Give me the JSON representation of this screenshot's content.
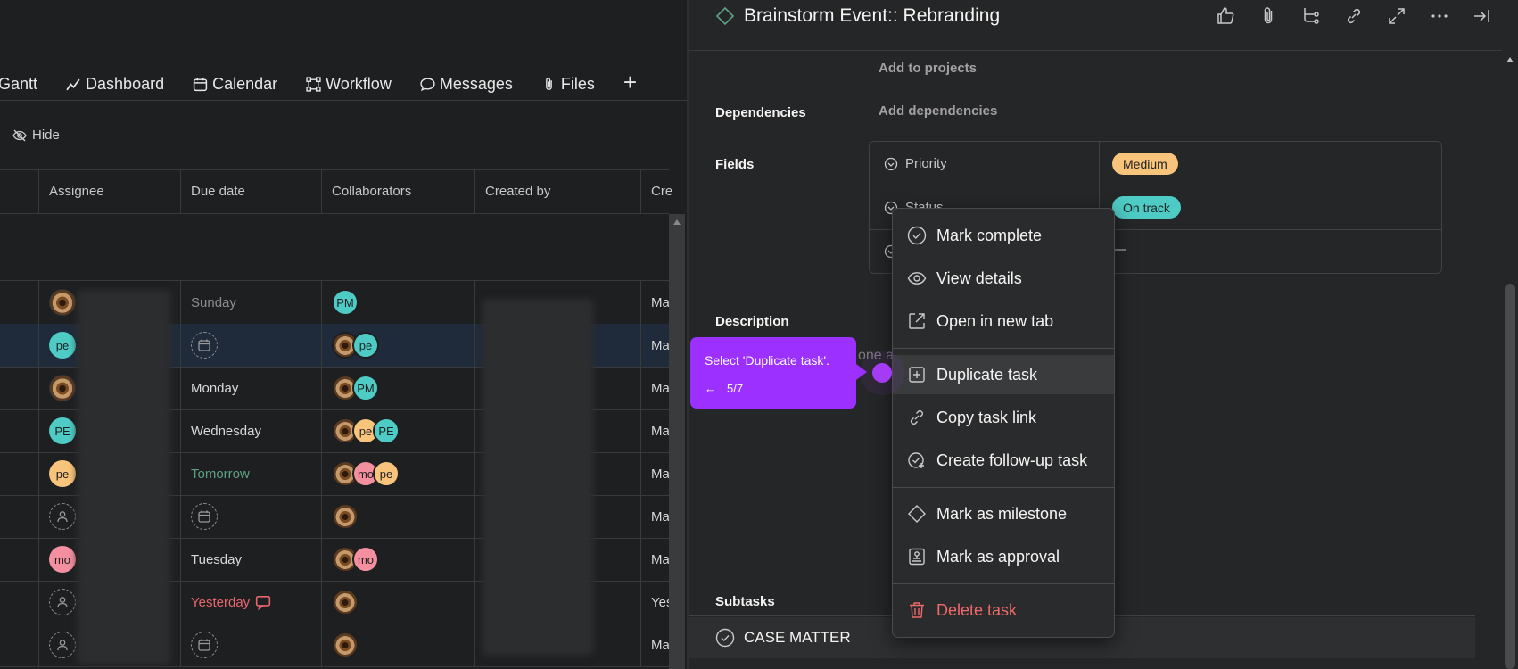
{
  "left": {
    "tabs": [
      "Gantt",
      "Dashboard",
      "Calendar",
      "Workflow",
      "Messages",
      "Files"
    ],
    "add_tab": "+",
    "hide_label": "Hide",
    "columns": [
      "Assignee",
      "Due date",
      "Collaborators",
      "Created by",
      "Cre"
    ],
    "rows": [
      {
        "due": "Sunday",
        "created_on": "Ma"
      },
      {
        "due": "",
        "created_on": "Ma"
      },
      {
        "due": "Monday",
        "created_on": "Ma"
      },
      {
        "due": "Wednesday",
        "created_on": "Ma"
      },
      {
        "due": "Tomorrow",
        "created_on": "Ma"
      },
      {
        "due": "",
        "created_on": "Ma"
      },
      {
        "due": "Tuesday",
        "created_on": "Ma"
      },
      {
        "due": "Yesterday",
        "created_on": "Yes"
      },
      {
        "due": "",
        "created_on": "Ma"
      }
    ],
    "avatars": {
      "pm": "PM",
      "pe": "pe",
      "pe_upper": "PE",
      "mo": "mo"
    }
  },
  "task": {
    "title": "Brainstorm Event:: Rebranding",
    "add_to_projects": "Add to projects",
    "dependencies_label": "Dependencies",
    "add_dependencies": "Add dependencies",
    "fields_label": "Fields",
    "fields": [
      {
        "name": "Priority",
        "value": "Medium",
        "color": "#f8c37a"
      },
      {
        "name": "Status",
        "value": "On track",
        "color": "#4ecbc4"
      },
      {
        "name": "",
        "value": "—"
      }
    ],
    "description_label": "Description",
    "description_partial": "one a",
    "subtasks_label": "Subtasks",
    "subtask": "CASE MATTER"
  },
  "menu": {
    "items": [
      {
        "label": "Mark complete",
        "icon": "check-circle-icon"
      },
      {
        "label": "View details",
        "icon": "eye-icon"
      },
      {
        "label": "Open in new tab",
        "icon": "external-link-icon"
      },
      {
        "label": "Duplicate task",
        "icon": "duplicate-icon"
      },
      {
        "label": "Copy task link",
        "icon": "link-icon"
      },
      {
        "label": "Create follow-up task",
        "icon": "follow-up-icon"
      },
      {
        "label": "Mark as milestone",
        "icon": "diamond-icon"
      },
      {
        "label": "Mark as approval",
        "icon": "approval-icon"
      },
      {
        "label": "Delete task",
        "icon": "trash-icon"
      }
    ]
  },
  "guide": {
    "instruction": "Select 'Duplicate task'.",
    "back_arrow": "←",
    "step": "5/7",
    "color": "#9b30ff"
  }
}
